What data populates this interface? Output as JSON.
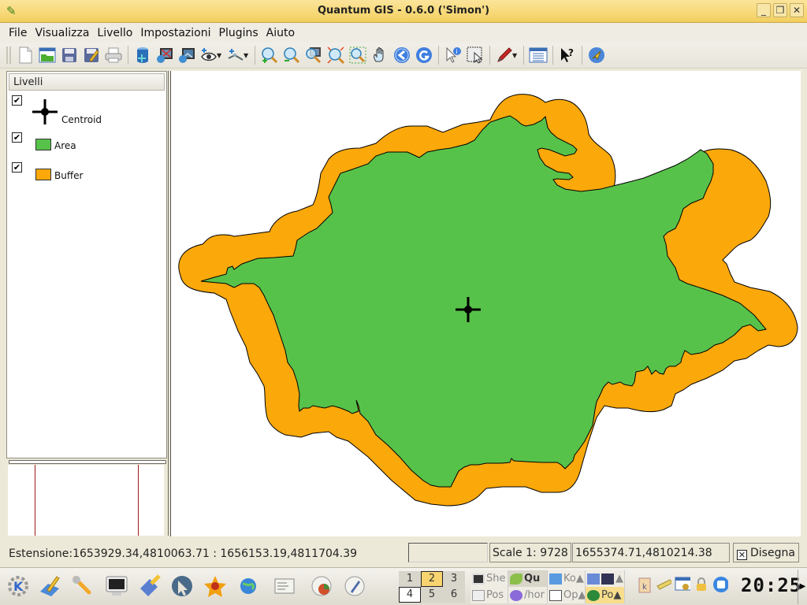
{
  "window": {
    "title": "Quantum GIS - 0.6.0 ('Simon')",
    "controls": {
      "minimize": "_",
      "restore": "❐",
      "close": "✕"
    }
  },
  "menubar": {
    "items": [
      {
        "label": "File",
        "mnemonic": "F"
      },
      {
        "label": "Visualizza",
        "mnemonic": "V"
      },
      {
        "label": "Livello",
        "mnemonic": "L"
      },
      {
        "label": "Impostazioni",
        "mnemonic": "s"
      },
      {
        "label": "Plugins",
        "mnemonic": "P"
      },
      {
        "label": "Aiuto",
        "mnemonic": "A"
      }
    ]
  },
  "toolbar": {
    "buttons": [
      "new-project-icon",
      "open-project-icon",
      "save-project-icon",
      "save-as-icon",
      "print-icon",
      "add-postgis-layer-icon",
      "add-raster-icon",
      "add-wms-icon",
      "add-vector-layer-icon",
      "add-vector-edit-icon",
      "zoom-in-icon",
      "zoom-out-icon",
      "zoom-full-icon",
      "zoom-selection-icon",
      "zoom-box-icon",
      "pan-icon",
      "zoom-previous-icon",
      "refresh-icon",
      "identify-icon",
      "select-icon",
      "capture-pencil-icon",
      "attribute-table-icon",
      "whats-this-icon",
      "gps-plugin-icon"
    ]
  },
  "legend": {
    "title": "Livelli",
    "layers": [
      {
        "name": "Centroid",
        "visible": true,
        "symbol": "cross-point"
      },
      {
        "name": "Area",
        "visible": true,
        "symbol": "fill",
        "color": "#57c24a"
      },
      {
        "name": "Buffer",
        "visible": true,
        "symbol": "fill",
        "color": "#fba80a"
      }
    ]
  },
  "map": {
    "background": "#ffffff",
    "layers": [
      {
        "name": "Buffer",
        "fill": "#fba80a",
        "stroke": "#000000"
      },
      {
        "name": "Area",
        "fill": "#57c24a",
        "stroke": "#000000"
      },
      {
        "name": "Centroid",
        "symbol": "cross-point",
        "color": "#000000"
      }
    ]
  },
  "statusbar": {
    "extent_label": "Estensione:",
    "extent_value": "1653929.34,4810063.71 : 1656153.19,4811704.39",
    "scale": "Scale 1: 9728",
    "coordinates": "1655374.71,4810214.38",
    "render_label": "Disegna",
    "render_checked": true
  },
  "taskbar": {
    "launchers": [
      "kde-menu-icon",
      "kwrite-icon",
      "control-center-icon",
      "terminal-icon",
      "kate-icon",
      "kopete-icon",
      "firefox-icon",
      "konqueror-icon",
      "kontact-icon",
      "kchart-icon",
      "kword-icon"
    ],
    "desktops": [
      "1",
      "2",
      "3",
      "4",
      "5",
      "6"
    ],
    "active_desktop": "2",
    "tasks": [
      {
        "label": "She",
        "icon": "terminal-icon",
        "state": "normal"
      },
      {
        "label": "Qu",
        "icon": "qgis-icon",
        "state": "active"
      },
      {
        "label": "Ko▲",
        "icon": "folder-icon",
        "state": "normal"
      },
      {
        "label": "▲",
        "icon": "kate-icon",
        "state": "normal"
      },
      {
        "label": "Pos",
        "icon": "kontact-icon",
        "state": "normal"
      },
      {
        "label": "/hor",
        "icon": "flower-icon",
        "state": "normal"
      },
      {
        "label": "Op▲",
        "icon": "document-icon",
        "state": "normal"
      },
      {
        "label": "Po▲",
        "icon": "globe-icon",
        "state": "highlight"
      }
    ],
    "tray": [
      "klipper-icon",
      "kpilot-icon",
      "korganizer-icon",
      "lock-icon",
      "stop-icon"
    ],
    "clock": "20:25"
  }
}
